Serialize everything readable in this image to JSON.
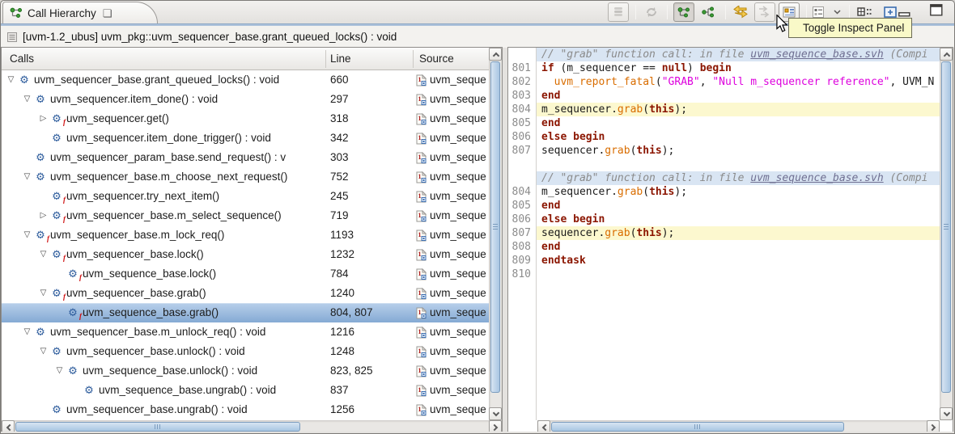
{
  "tab": {
    "title": "Call Hierarchy",
    "icon": "call-hierarchy-icon",
    "close_icon": "close-icon"
  },
  "toolbar": {
    "tooltip": "Toggle Inspect Panel",
    "icons": [
      "layers-icon",
      "refresh-icon",
      "caller-hierarchy-icon",
      "callee-hierarchy-icon",
      "toggle-direction-icon",
      "next-occurrence-icon",
      "toggle-inspect-panel-icon",
      "view-list-icon",
      "chevron-down-icon",
      "grid-dots-icon",
      "fast-view-icon",
      "minimize-icon",
      "maximize-icon"
    ]
  },
  "context_bar": {
    "label": "[uvm-1.2_ubus] uvm_pkg::uvm_sequencer_base.grant_queued_locks() : void"
  },
  "tree": {
    "columns": [
      "Calls",
      "Line",
      "Source"
    ],
    "source_text": "uvm_seque",
    "rows": [
      {
        "label": "uvm_sequencer_base.grant_queued_locks() : void",
        "line": "660",
        "depth": 0,
        "arrow": "down",
        "task": false,
        "selected": false
      },
      {
        "label": "uvm_sequencer.item_done() : void",
        "line": "297",
        "depth": 1,
        "arrow": "down",
        "task": false,
        "selected": false
      },
      {
        "label": "uvm_sequencer.get()",
        "line": "318",
        "depth": 2,
        "arrow": "right",
        "task": true,
        "selected": false
      },
      {
        "label": "uvm_sequencer.item_done_trigger() : void",
        "line": "342",
        "depth": 2,
        "arrow": "none",
        "task": false,
        "selected": false
      },
      {
        "label": "uvm_sequencer_param_base.send_request() : v",
        "line": "303",
        "depth": 1,
        "arrow": "none",
        "task": false,
        "selected": false
      },
      {
        "label": "uvm_sequencer_base.m_choose_next_request()",
        "line": "752",
        "depth": 1,
        "arrow": "down",
        "task": false,
        "selected": false
      },
      {
        "label": "uvm_sequencer.try_next_item()",
        "line": "245",
        "depth": 2,
        "arrow": "none",
        "task": true,
        "selected": false
      },
      {
        "label": "uvm_sequencer_base.m_select_sequence()",
        "line": "719",
        "depth": 2,
        "arrow": "right",
        "task": true,
        "selected": false
      },
      {
        "label": "uvm_sequencer_base.m_lock_req()",
        "line": "1193",
        "depth": 1,
        "arrow": "down",
        "task": true,
        "selected": false
      },
      {
        "label": "uvm_sequencer_base.lock()",
        "line": "1232",
        "depth": 2,
        "arrow": "down",
        "task": true,
        "selected": false
      },
      {
        "label": "uvm_sequence_base.lock()",
        "line": "784",
        "depth": 3,
        "arrow": "none",
        "task": true,
        "selected": false
      },
      {
        "label": "uvm_sequencer_base.grab()",
        "line": "1240",
        "depth": 2,
        "arrow": "down",
        "task": true,
        "selected": false
      },
      {
        "label": "uvm_sequence_base.grab()",
        "line": "804, 807",
        "depth": 3,
        "arrow": "none",
        "task": true,
        "selected": true
      },
      {
        "label": "uvm_sequencer_base.m_unlock_req() : void",
        "line": "1216",
        "depth": 1,
        "arrow": "down",
        "task": false,
        "selected": false
      },
      {
        "label": "uvm_sequencer_base.unlock() : void",
        "line": "1248",
        "depth": 2,
        "arrow": "down",
        "task": false,
        "selected": false
      },
      {
        "label": "uvm_sequence_base.unlock() : void",
        "line": "823, 825",
        "depth": 3,
        "arrow": "down",
        "task": false,
        "selected": false
      },
      {
        "label": "uvm_sequence_base.ungrab() : void",
        "line": "837",
        "depth": 4,
        "arrow": "none",
        "task": false,
        "selected": false
      },
      {
        "label": "uvm_sequencer_base.ungrab() : void",
        "line": "1256",
        "depth": 2,
        "arrow": "none",
        "task": false,
        "selected": false
      }
    ]
  },
  "editor": {
    "lines": [
      {
        "num": "",
        "bg": "blue",
        "seg": [
          [
            "// \"grab\" function call: in file ",
            "c"
          ],
          [
            "uvm_sequence_base.svh",
            "l"
          ],
          [
            " (Compi",
            "c"
          ]
        ]
      },
      {
        "num": "801",
        "bg": "",
        "seg": [
          [
            "if",
            "k"
          ],
          [
            " (m_sequencer == ",
            "p"
          ],
          [
            "null",
            "k"
          ],
          [
            ") ",
            "p"
          ],
          [
            "begin",
            "k"
          ]
        ]
      },
      {
        "num": "802",
        "bg": "",
        "seg": [
          [
            "  ",
            "p"
          ],
          [
            "uvm_report_fatal",
            "f"
          ],
          [
            "(",
            "p"
          ],
          [
            "\"GRAB\"",
            "s"
          ],
          [
            ", ",
            "p"
          ],
          [
            "\"Null m_sequencer reference\"",
            "s"
          ],
          [
            ", UVM_N",
            "p"
          ]
        ]
      },
      {
        "num": "803",
        "bg": "",
        "seg": [
          [
            "end",
            "k"
          ]
        ]
      },
      {
        "num": "804",
        "bg": "yellow",
        "seg": [
          [
            "m_sequencer.",
            "p"
          ],
          [
            "grab",
            "f"
          ],
          [
            "(",
            "p"
          ],
          [
            "this",
            "k"
          ],
          [
            ");",
            "p"
          ]
        ]
      },
      {
        "num": "805",
        "bg": "",
        "seg": [
          [
            "end",
            "k"
          ]
        ]
      },
      {
        "num": "806",
        "bg": "",
        "seg": [
          [
            "else",
            "k"
          ],
          [
            " ",
            "p"
          ],
          [
            "begin",
            "k"
          ]
        ]
      },
      {
        "num": "807",
        "bg": "",
        "seg": [
          [
            "sequencer.",
            "p"
          ],
          [
            "grab",
            "f"
          ],
          [
            "(",
            "p"
          ],
          [
            "this",
            "k"
          ],
          [
            ");",
            "p"
          ]
        ]
      },
      {
        "num": "",
        "bg": "",
        "seg": []
      },
      {
        "num": "",
        "bg": "blue",
        "seg": [
          [
            "// \"grab\" function call: in file ",
            "c"
          ],
          [
            "uvm_sequence_base.svh",
            "l"
          ],
          [
            " (Compi",
            "c"
          ]
        ]
      },
      {
        "num": "804",
        "bg": "",
        "seg": [
          [
            "m_sequencer.",
            "p"
          ],
          [
            "grab",
            "f"
          ],
          [
            "(",
            "p"
          ],
          [
            "this",
            "k"
          ],
          [
            ");",
            "p"
          ]
        ]
      },
      {
        "num": "805",
        "bg": "",
        "seg": [
          [
            "end",
            "k"
          ]
        ]
      },
      {
        "num": "806",
        "bg": "",
        "seg": [
          [
            "else",
            "k"
          ],
          [
            " ",
            "p"
          ],
          [
            "begin",
            "k"
          ]
        ]
      },
      {
        "num": "807",
        "bg": "yellow",
        "seg": [
          [
            "sequencer.",
            "p"
          ],
          [
            "grab",
            "f"
          ],
          [
            "(",
            "p"
          ],
          [
            "this",
            "k"
          ],
          [
            ");",
            "p"
          ]
        ]
      },
      {
        "num": "808",
        "bg": "",
        "seg": [
          [
            "end",
            "k"
          ]
        ]
      },
      {
        "num": "809",
        "bg": "",
        "seg": [
          [
            "endtask",
            "k"
          ]
        ]
      },
      {
        "num": "810",
        "bg": "",
        "seg": []
      }
    ]
  },
  "colors": {
    "selection_blue": "#85aad4",
    "occurrence_yellow": "#fcf8cf",
    "context_line_blue": "#d9e5f3",
    "keyword": "#8b1500",
    "function_call": "#d96d00",
    "string": "#dd00dd",
    "comment": "#8a8a8a"
  }
}
